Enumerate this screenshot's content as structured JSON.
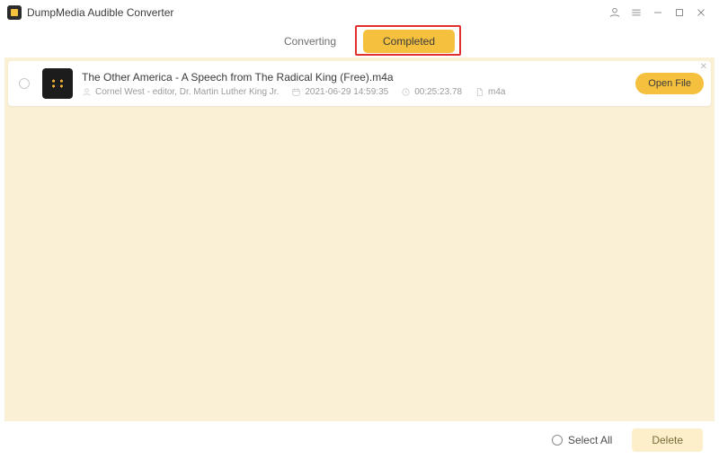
{
  "app": {
    "title": "DumpMedia Audible Converter"
  },
  "tabs": {
    "converting": "Converting",
    "completed": "Completed"
  },
  "file": {
    "name": "The Other America - A Speech from The Radical King (Free).m4a",
    "author": "Cornel West - editor, Dr. Martin Luther King Jr.",
    "date": "2021-06-29 14:59:35",
    "duration": "00:25:23.78",
    "format": "m4a",
    "open_label": "Open File"
  },
  "footer": {
    "select_all": "Select All",
    "delete": "Delete"
  }
}
